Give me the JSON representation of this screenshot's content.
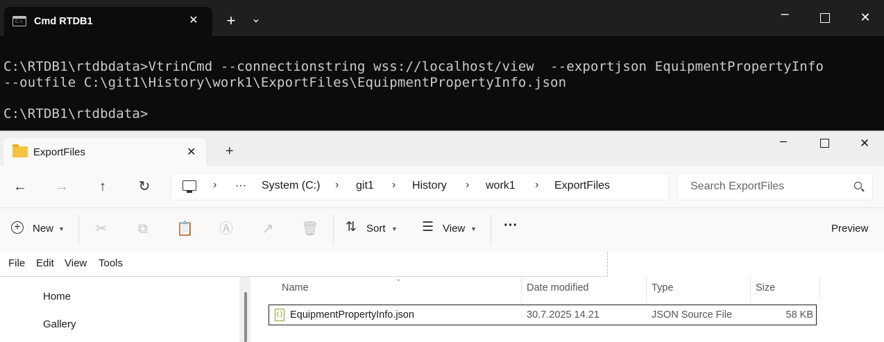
{
  "terminal": {
    "tab_title": "Cmd RTDB1",
    "new_tab": "+",
    "dropdown": "⌄",
    "lines": [
      "C:\\RTDB1\\rtdbdata>VtrinCmd --connectionstring wss://localhost/view  --exportjson EquipmentPropertyInfo",
      "--outfile C:\\git1\\History\\work1\\ExportFiles\\EquipmentPropertyInfo.json",
      "C:\\RTDB1\\rtdbdata>"
    ]
  },
  "explorer": {
    "tab_title": "ExportFiles",
    "new_tab": "+",
    "breadcrumb": {
      "more": "···",
      "items": [
        "System (C:)",
        "git1",
        "History",
        "work1",
        "ExportFiles"
      ]
    },
    "search_placeholder": "Search ExportFiles",
    "toolbar": {
      "new_label": "New",
      "sort_label": "Sort",
      "view_label": "View",
      "more_label": "···",
      "preview_label": "Preview"
    },
    "menu": [
      "File",
      "Edit",
      "View",
      "Tools"
    ],
    "nav_items": [
      "Home",
      "Gallery"
    ],
    "columns": [
      "Name",
      "Date modified",
      "Type",
      "Size"
    ],
    "files": [
      {
        "name": "EquipmentPropertyInfo.json",
        "date": "30.7.2025 14.21",
        "type": "JSON Source File",
        "size": "58 KB"
      }
    ]
  }
}
